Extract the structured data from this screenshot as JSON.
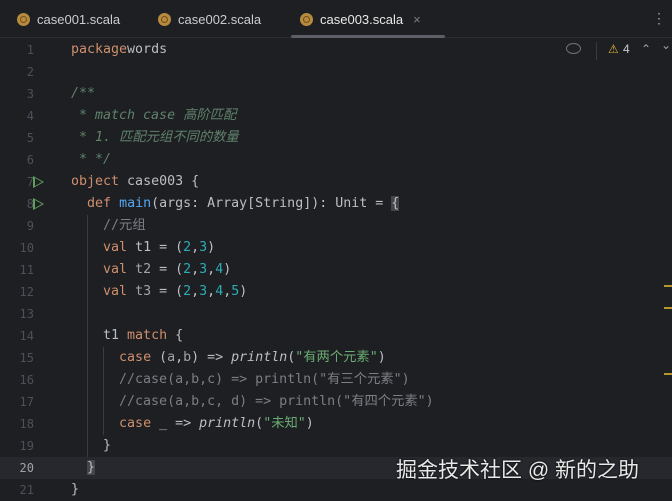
{
  "tabs": [
    {
      "label": "case001.scala"
    },
    {
      "label": "case002.scala"
    },
    {
      "label": "case003.scala",
      "active": true
    }
  ],
  "tab_close": "×",
  "more_menu": "⋮",
  "inspection": {
    "warning_count": "4",
    "warning_icon": "⚠",
    "up": "⌃",
    "down": "⌄"
  },
  "current_line": 20,
  "lines": [
    {
      "n": "1",
      "t": [
        [
          "kw",
          "package"
        ],
        [
          "",
          "words"
        ]
      ]
    },
    {
      "n": "2",
      "t": []
    },
    {
      "n": "3",
      "t": [
        [
          "doc",
          "/**"
        ]
      ]
    },
    {
      "n": "4",
      "t": [
        [
          "doc",
          " * match case 高阶匹配"
        ]
      ]
    },
    {
      "n": "5",
      "t": [
        [
          "doc",
          " * 1. 匹配元组不同的数量"
        ]
      ]
    },
    {
      "n": "6",
      "t": [
        [
          "doc",
          " * */"
        ]
      ]
    },
    {
      "n": "7",
      "t": [
        [
          "kw",
          "object"
        ],
        [
          "",
          " case003 {"
        ]
      ],
      "run": true
    },
    {
      "n": "8",
      "t": [
        [
          "",
          "  "
        ],
        [
          "kw",
          "def"
        ],
        [
          "",
          " "
        ],
        [
          "fn",
          "main"
        ],
        [
          "",
          "(args: Array[String]): Unit = "
        ],
        [
          "bracket",
          "{"
        ]
      ],
      "run": true
    },
    {
      "n": "9",
      "t": [
        [
          "cm",
          "    //元组"
        ]
      ]
    },
    {
      "n": "10",
      "t": [
        [
          "",
          "    "
        ],
        [
          "kw",
          "val"
        ],
        [
          "",
          " t1 = ("
        ],
        [
          "num",
          "2"
        ],
        [
          "",
          ","
        ],
        [
          "num",
          "3"
        ],
        [
          "",
          ")"
        ]
      ]
    },
    {
      "n": "11",
      "t": [
        [
          "",
          "    "
        ],
        [
          "kw",
          "val"
        ],
        [
          "",
          " "
        ],
        [
          "pm",
          "t2"
        ],
        [
          "",
          " = ("
        ],
        [
          "num",
          "2"
        ],
        [
          "",
          ","
        ],
        [
          "num",
          "3"
        ],
        [
          "",
          ","
        ],
        [
          "num",
          "4"
        ],
        [
          "",
          ")"
        ]
      ]
    },
    {
      "n": "12",
      "t": [
        [
          "",
          "    "
        ],
        [
          "kw",
          "val"
        ],
        [
          "",
          " "
        ],
        [
          "pm",
          "t3"
        ],
        [
          "",
          " = ("
        ],
        [
          "num",
          "2"
        ],
        [
          "",
          ","
        ],
        [
          "num",
          "3"
        ],
        [
          "",
          ","
        ],
        [
          "num",
          "4"
        ],
        [
          "",
          ","
        ],
        [
          "num",
          "5"
        ],
        [
          "",
          ")"
        ]
      ]
    },
    {
      "n": "13",
      "t": []
    },
    {
      "n": "14",
      "t": [
        [
          "",
          "    t1 "
        ],
        [
          "kw",
          "match"
        ],
        [
          "",
          " {"
        ]
      ]
    },
    {
      "n": "15",
      "t": [
        [
          "",
          "      "
        ],
        [
          "kw",
          "case"
        ],
        [
          "",
          " ("
        ],
        [
          "pm",
          "a"
        ],
        [
          "",
          ","
        ],
        [
          "pm",
          "b"
        ],
        [
          "",
          ") => "
        ],
        [
          "it",
          "println"
        ],
        [
          "",
          "("
        ],
        [
          "str",
          "\"有两个元素\""
        ],
        [
          "",
          ")"
        ]
      ]
    },
    {
      "n": "16",
      "t": [
        [
          "cm",
          "      //case(a,b,c) => println(\"有三个元素\")"
        ]
      ]
    },
    {
      "n": "17",
      "t": [
        [
          "cm",
          "      //case(a,b,c, d) => println(\"有四个元素\")"
        ]
      ]
    },
    {
      "n": "18",
      "t": [
        [
          "",
          "      "
        ],
        [
          "kw",
          "case"
        ],
        [
          "",
          " _ => "
        ],
        [
          "it",
          "println"
        ],
        [
          "",
          "("
        ],
        [
          "str",
          "\"未知\""
        ],
        [
          "",
          ")"
        ]
      ]
    },
    {
      "n": "19",
      "t": [
        [
          "",
          "    }"
        ]
      ]
    },
    {
      "n": "20",
      "t": [
        [
          "",
          "  "
        ],
        [
          "bracket",
          "}"
        ]
      ]
    },
    {
      "n": "21",
      "t": [
        [
          "",
          "}"
        ]
      ]
    }
  ],
  "watermark": "掘金技术社区 @ 新的之助",
  "colors": {
    "background": "#1e1f22",
    "keyword": "#cf8e6d",
    "number": "#2aacb8",
    "string": "#6aab73",
    "function": "#56a8f5"
  }
}
